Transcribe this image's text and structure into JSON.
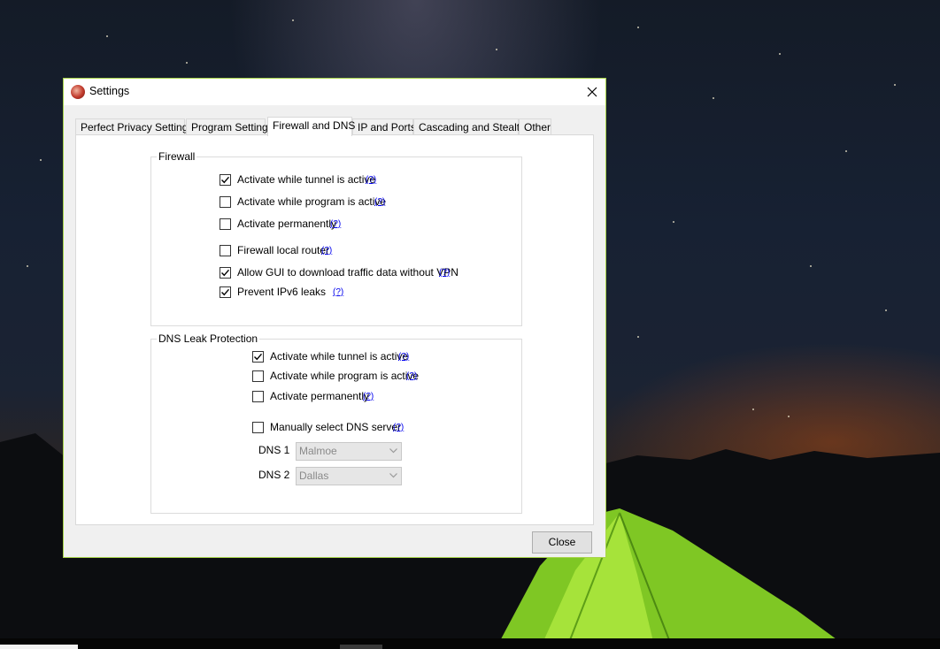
{
  "window": {
    "title": "Settings",
    "border_color": "#a8d44a"
  },
  "tabs": [
    {
      "label": "Perfect Privacy Settings"
    },
    {
      "label": "Program Settings"
    },
    {
      "label": "Firewall and DNS",
      "active": true
    },
    {
      "label": "IP and Ports"
    },
    {
      "label": "Cascading and Stealth"
    },
    {
      "label": "Other"
    }
  ],
  "help_text": "(?)",
  "firewall": {
    "legend": "Firewall",
    "options": [
      {
        "label": "Activate while tunnel is active",
        "checked": true
      },
      {
        "label": "Activate while program is active",
        "checked": false
      },
      {
        "label": "Activate permanently",
        "checked": false
      },
      {
        "label": "Firewall local router",
        "checked": false
      },
      {
        "label": "Allow GUI to download traffic data without VPN",
        "checked": true
      },
      {
        "label": "Prevent IPv6 leaks",
        "checked": true
      }
    ]
  },
  "dns": {
    "legend": "DNS Leak Protection",
    "options": [
      {
        "label": "Activate while tunnel is active",
        "checked": true
      },
      {
        "label": "Activate while program is active",
        "checked": false
      },
      {
        "label": "Activate permanently",
        "checked": false
      },
      {
        "label": "Manually select DNS server",
        "checked": false
      }
    ],
    "dns1_label": "DNS 1",
    "dns1_value": "Malmoe",
    "dns2_label": "DNS 2",
    "dns2_value": "Dallas"
  },
  "buttons": {
    "close_label": "Close"
  },
  "icons": {
    "window_close": "close-icon",
    "app": "app-logo-icon",
    "dropdown": "chevron-down-icon",
    "check": "check-icon"
  }
}
